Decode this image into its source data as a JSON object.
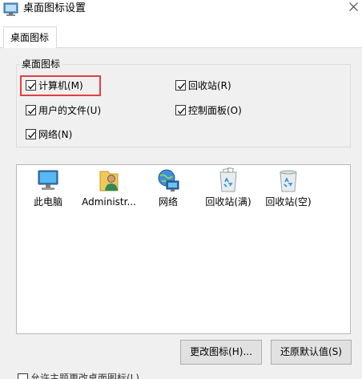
{
  "window": {
    "title": "桌面图标设置",
    "close_icon": "close-icon"
  },
  "tabs": [
    {
      "label": "桌面图标",
      "selected": true
    }
  ],
  "desktop_icons_group": {
    "title": "桌面图标",
    "checkboxes": [
      {
        "label": "计算机(M)",
        "checked": true,
        "highlighted": true
      },
      {
        "label": "回收站(R)",
        "checked": true
      },
      {
        "label": "用户的文件(U)",
        "checked": true
      },
      {
        "label": "控制面板(O)",
        "checked": true
      },
      {
        "label": "网络(N)",
        "checked": true
      }
    ],
    "highlight_color": "#e04040"
  },
  "icon_list": {
    "items": [
      {
        "label": "此电脑",
        "icon": "computer-icon"
      },
      {
        "label": "Administr...",
        "icon": "user-folder-icon"
      },
      {
        "label": "网络",
        "icon": "network-icon"
      },
      {
        "label": "回收站(满)",
        "icon": "recycle-bin-full-icon"
      },
      {
        "label": "回收站(空)",
        "icon": "recycle-bin-empty-icon"
      }
    ]
  },
  "buttons": {
    "change_icon": "更改图标(H)...",
    "restore_default": "还原默认值(S)"
  },
  "bottom_option": {
    "label": "允许主题更改桌面图标(L)",
    "checked": true
  }
}
